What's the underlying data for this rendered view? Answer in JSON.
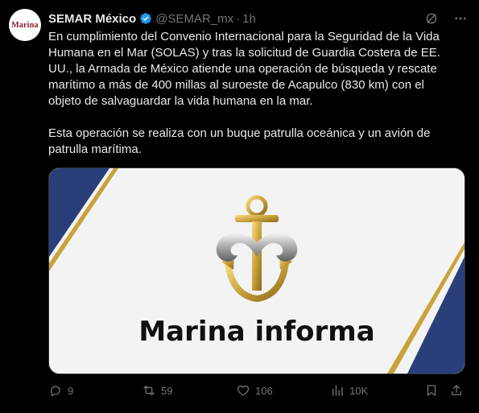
{
  "tweet": {
    "author_name": "SEMAR México",
    "handle": "@SEMAR_mx",
    "separator": "·",
    "time": "1h",
    "avatar_text": "Marina",
    "text": "En cumplimiento del Convenio Internacional para la Seguridad de la Vida\nHumana en el Mar (SOLAS) y tras la solicitud de Guardia Costera de EE.\nUU., la Armada de México atiende una operación de búsqueda y rescate\nmarítimo a más de 400 millas al suroeste de Acapulco (830 km) con el\nobjeto de salvaguardar la vida humana en la mar.\n\nEsta operación se realiza con un buque patrulla oceánica y un avión de\npatrulla marítima.",
    "media_caption": "Marina informa"
  },
  "actions": {
    "replies": "9",
    "retweets": "59",
    "likes": "106",
    "views": "10K"
  },
  "icons": {
    "verified": "verified-badge-icon",
    "grok": "grok-icon",
    "more": "more-icon",
    "reply": "reply-icon",
    "retweet": "retweet-icon",
    "like": "like-icon",
    "views": "views-icon",
    "bookmark": "bookmark-icon",
    "share": "share-icon"
  },
  "colors": {
    "background": "#000000",
    "text": "#e7e9ea",
    "secondary": "#71767b",
    "verified": "#1d9bf0",
    "navy": "#2a3f7a",
    "gold": "#c9a23a"
  }
}
